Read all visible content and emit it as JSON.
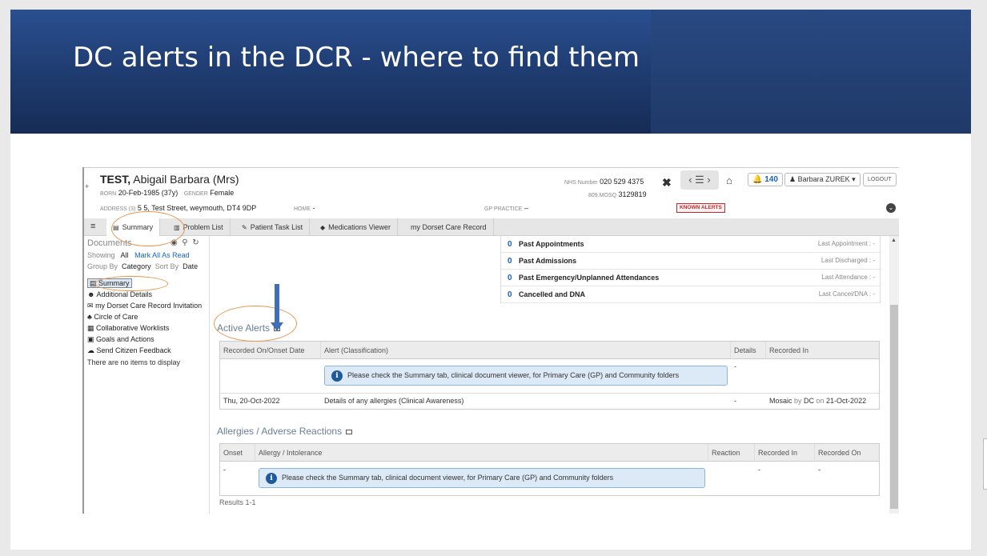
{
  "slide": {
    "title": "DC alerts in the DCR - where to find them"
  },
  "patient": {
    "surname": "TEST,",
    "given": " Abigail Barbara (Mrs)",
    "born_label": "BORN",
    "born": "20-Feb-1985 (37y)",
    "gender_label": "GENDER",
    "gender": "Female",
    "address_label": "ADDRESS (3)",
    "address": "5 5, Test Street, weymouth, DT4 9DP",
    "home_label": "HOME",
    "home": "-",
    "gp_label": "GP PRACTICE",
    "gp": "–",
    "nhs_label": "NHS Number",
    "nhs": "020 529 4375",
    "mosq_label": "809.MOSQ",
    "mosq": "3129819",
    "known_alerts": "KNOWN ALERTS"
  },
  "topbar": {
    "notifications": "140",
    "user": "Barbara ZUREK",
    "logout": "LOGOUT"
  },
  "tabs": [
    {
      "label": "Summary",
      "icon": "summary-icon"
    },
    {
      "label": "Problem List",
      "icon": "chart-icon"
    },
    {
      "label": "Patient Task List",
      "icon": "task-icon"
    },
    {
      "label": "Medications Viewer",
      "icon": "pill-icon"
    },
    {
      "label": "my Dorset Care Record",
      "icon": ""
    }
  ],
  "sidebar": {
    "title": "Documents",
    "showing_label": "Showing",
    "showing_value": "All",
    "mark_all": "Mark All As Read",
    "group_by_label": "Group By",
    "group_by_value": "Category",
    "sort_by_label": "Sort By",
    "sort_by_value": "Date",
    "items": [
      {
        "label": "Summary",
        "icon": "summary-icon"
      },
      {
        "label": "Additional Details",
        "icon": "people-icon"
      },
      {
        "label": "my Dorset Care Record Invitation",
        "icon": "envelope-icon"
      },
      {
        "label": "Circle of Care",
        "icon": "group-icon"
      },
      {
        "label": "Collaborative Worklists",
        "icon": "worklist-icon"
      },
      {
        "label": "Goals and Actions",
        "icon": "goals-icon"
      },
      {
        "label": "Send Citizen Feedback",
        "icon": "feedback-icon"
      }
    ],
    "empty": "There are no items to display"
  },
  "stats": [
    {
      "count": "0",
      "label": "Past Appointments",
      "right": "Last Appointment : -"
    },
    {
      "count": "0",
      "label": "Past Admissions",
      "right": "Last Discharged : -"
    },
    {
      "count": "0",
      "label": "Past Emergency/Unplanned Attendances",
      "right": "Last Attendance : -"
    },
    {
      "count": "0",
      "label": "Cancelled and DNA",
      "right": "Last Cancel/DNA : -"
    }
  ],
  "alerts": {
    "title": "Active Alerts",
    "headers": [
      "Recorded On/Onset Date",
      "Alert (Classification)",
      "Details",
      "Recorded In"
    ],
    "info": "Please check the Summary tab, clinical document viewer, for Primary Care (GP) and Community folders",
    "info_details": "-",
    "row": {
      "date": "Thu, 20-Oct-2022",
      "alert": "Details of any allergies (Clinical Awareness)",
      "details": "-",
      "recorded_app": "Mosaic",
      "recorded_by_word": " by ",
      "recorded_by": "DC",
      "recorded_on_word": " on ",
      "recorded_on": "21-Oct-2022"
    }
  },
  "allergies": {
    "title": "Allergies / Adverse Reactions",
    "headers": [
      "Onset",
      "Allergy / Intolerance",
      "Reaction",
      "Recorded In",
      "Recorded On"
    ],
    "onset": "-",
    "info": "Please check the Summary tab, clinical document viewer, for Primary Care (GP) and Community folders",
    "recorded_in": "-",
    "recorded_on": "-",
    "results": "Results 1-1"
  }
}
